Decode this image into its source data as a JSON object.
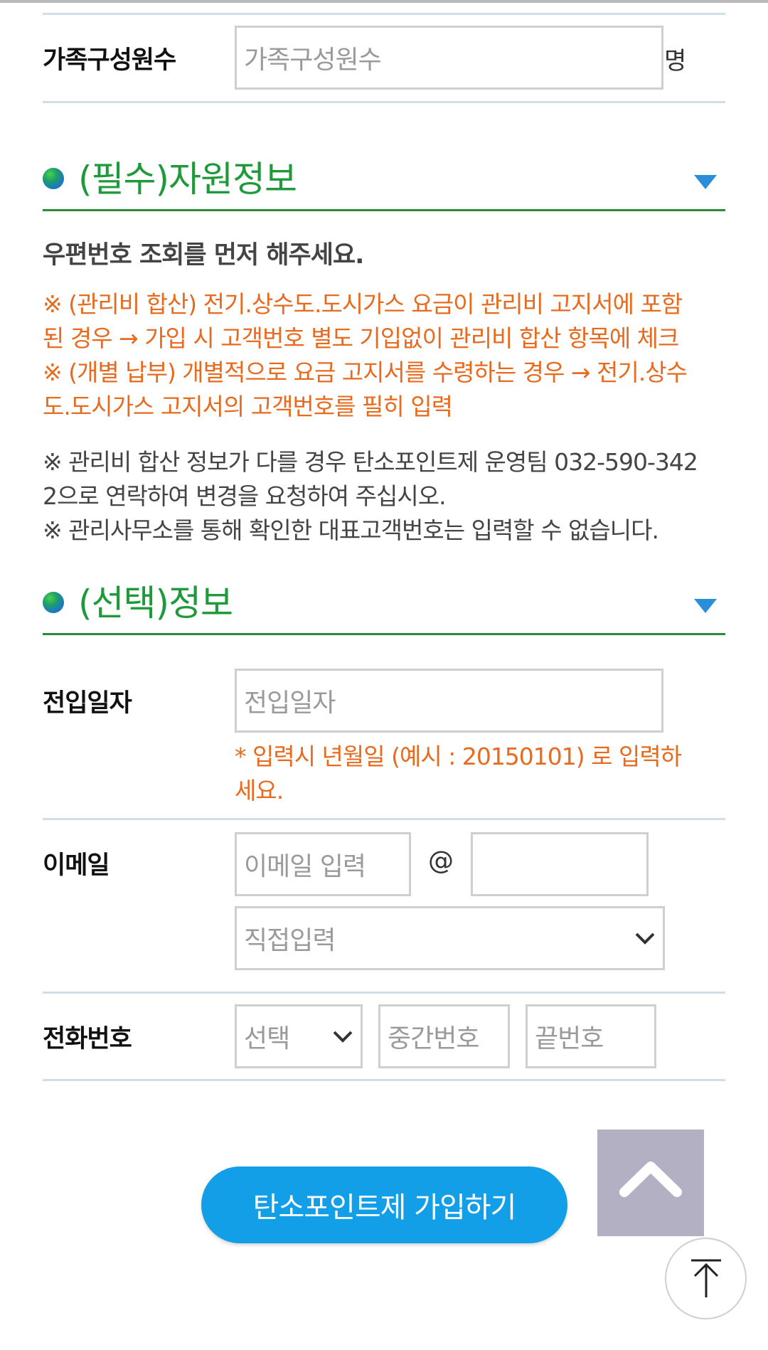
{
  "family": {
    "label": "가족구성원수",
    "placeholder": "가족구성원수",
    "unit": "명"
  },
  "required_section": {
    "title": "(필수)자원정보",
    "intro": "우편번호 조회를 먼저 해주세요.",
    "orange_notes": [
      "※ (관리비 합산) 전기.상수도.도시가스 요금이 관리비 고지서에 포함",
      "된 경우 → 가입 시 고객번호 별도 기입없이 관리비 합산 항목에 체크",
      "※ (개별 납부) 개별적으로 요금 고지서를 수령하는 경우 → 전기.상수",
      "도.도시가스 고지서의 고객번호를 필히 입력"
    ],
    "gray_notes": [
      "※ 관리비 합산 정보가 다를 경우 탄소포인트제 운영팀 032-590-342",
      "2으로 연락하여 변경을 요청하여 주십시오.",
      "※ 관리사무소를 통해 확인한 대표고객번호는 입력할 수 없습니다."
    ]
  },
  "optional_section": {
    "title": "(선택)정보",
    "move_in": {
      "label": "전입일자",
      "placeholder": "전입일자",
      "hint_line1": "* 입력시 년월일 (예시 : 20150101) 로 입력하",
      "hint_line2": "세요."
    },
    "email": {
      "label": "이메일",
      "local_placeholder": "이메일 입력",
      "at": "@",
      "domain_placeholder": "",
      "domain_select": "직접입력"
    },
    "phone": {
      "label": "전화번호",
      "prefix_select": "선택",
      "middle_placeholder": "중간번호",
      "last_placeholder": "끝번호"
    }
  },
  "buttons": {
    "join": "탄소포인트제 가입하기"
  },
  "icons": {
    "section_bullet": "green-blue-dot-icon",
    "collapse": "triangle-down-icon",
    "select_chevron": "chevron-down-icon",
    "scroll_up": "chevron-up-icon",
    "back_to_top": "arrow-up-to-top-icon"
  },
  "colors": {
    "accent_green": "#1f9a3a",
    "notice_orange": "#e86a1e",
    "button_blue": "#139ee8",
    "triangle_blue": "#2a8fd8"
  }
}
